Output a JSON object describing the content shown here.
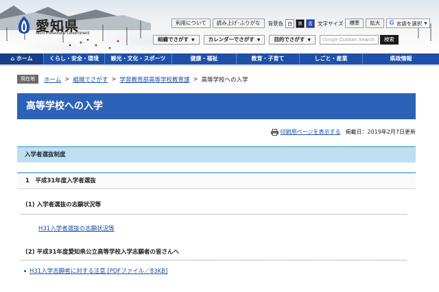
{
  "site": {
    "name": "愛知県",
    "name_en": "Aichi Prefectural Government"
  },
  "toolbar": {
    "about_label": "利用について",
    "read_aloud_label": "読み上げ･ふりがな",
    "bgcolor_label": "背景色",
    "bg_white": "白",
    "bg_black": "黒",
    "bg_blue": "青",
    "fontsize_label": "文字サイズ",
    "font_standard": "標準",
    "font_large": "拡大",
    "translate_label": "言語を選択"
  },
  "finders": {
    "by_org": "組織でさがす",
    "by_calendar": "カレンダーでさがす",
    "by_purpose": "目的でさがす"
  },
  "search": {
    "placeholder": "Custom Search",
    "button_label": "検索"
  },
  "global_nav": [
    {
      "label": "ホーム"
    },
    {
      "label": "くらし・安全・環境"
    },
    {
      "label": "観光・文化・スポーツ"
    },
    {
      "label": "健康・福祉"
    },
    {
      "label": "教育・子育て"
    },
    {
      "label": "しごと・産業"
    },
    {
      "label": "県政情報"
    }
  ],
  "breadcrumb": {
    "tag": "現在地",
    "items": [
      "ホーム",
      "組織でさがす",
      "学習教育部高等学校教育課",
      "高等学校への入学"
    ]
  },
  "page": {
    "title": "高等学校への入学",
    "print_link": "印刷用ページを表示する",
    "published": "掲載日：2019年2月7日更新",
    "section_heading": "入学者選抜制度",
    "subsection_heading": "1　平成31年度入学者選抜",
    "item1_heading": "(1) 入学者選抜の志願状況等",
    "item1_link": "H31入学者選抜の志願状況等",
    "item2_heading": "(2) 平成31年度愛知県公立高等学校入学志願者の皆さんへ",
    "item2_link": "H31入学志願者に対する注意 [PDFファイル／83KB]"
  }
}
